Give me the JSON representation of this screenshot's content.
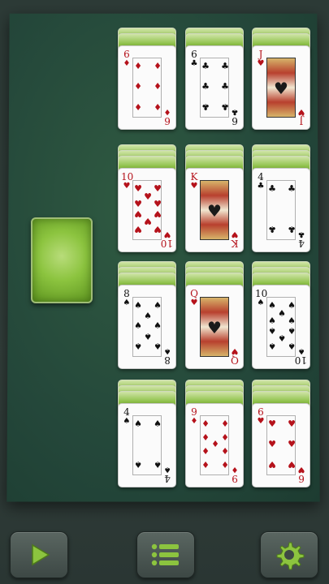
{
  "game": {
    "columns": [
      {
        "pile": [
          {
            "rank": "6",
            "suit": "♦",
            "color": "red",
            "backs": 2
          },
          {
            "rank": "10",
            "suit": "♥",
            "color": "red",
            "backs": 3
          },
          {
            "rank": "8",
            "suit": "♠",
            "color": "black",
            "backs": 3
          },
          {
            "rank": "4",
            "suit": "♠",
            "color": "black",
            "backs": 3
          }
        ]
      },
      {
        "pile": [
          {
            "rank": "6",
            "suit": "♣",
            "color": "black",
            "backs": 2
          },
          {
            "rank": "K",
            "suit": "♥",
            "color": "red",
            "backs": 3
          },
          {
            "rank": "Q",
            "suit": "♥",
            "color": "red",
            "backs": 3
          },
          {
            "rank": "9",
            "suit": "♦",
            "color": "red",
            "backs": 3
          }
        ]
      },
      {
        "pile": [
          {
            "rank": "J",
            "suit": "♥",
            "color": "red",
            "backs": 2
          },
          {
            "rank": "4",
            "suit": "♣",
            "color": "black",
            "backs": 3
          },
          {
            "rank": "10",
            "suit": "♠",
            "color": "black",
            "backs": 3
          },
          {
            "rank": "6",
            "suit": "♥",
            "color": "red",
            "backs": 3
          }
        ]
      }
    ]
  },
  "toolbar": {
    "play_icon": "play-icon",
    "menu_icon": "menu-icon",
    "settings_icon": "gear-icon"
  },
  "colors": {
    "accent": "#8cc43f",
    "felt": "#24473a"
  }
}
